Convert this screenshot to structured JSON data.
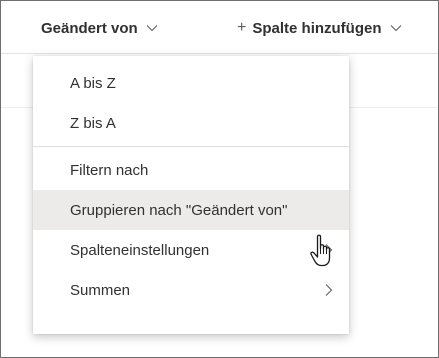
{
  "header": {
    "changed_by_label": "Geändert von",
    "add_column_label": "Spalte hinzufügen",
    "add_column_prefix": "+"
  },
  "menu": {
    "items": [
      {
        "label": "A bis Z"
      },
      {
        "label": "Z bis A"
      },
      {
        "label": "Filtern nach"
      },
      {
        "label": "Gruppieren nach \"Geändert von\""
      },
      {
        "label": "Spalteneinstellungen",
        "has_submenu": true
      },
      {
        "label": "Summen",
        "has_submenu": true
      }
    ],
    "highlighted_item": "Gruppieren nach \"Geändert von\""
  },
  "colors": {
    "hover_background": "#edebe9",
    "text": "#323130",
    "divider": "#e1dfdd"
  },
  "icons": {
    "header_dropdown": "chevron-down-icon",
    "submenu": "chevron-right-icon",
    "pointer": "hand-cursor-icon"
  }
}
